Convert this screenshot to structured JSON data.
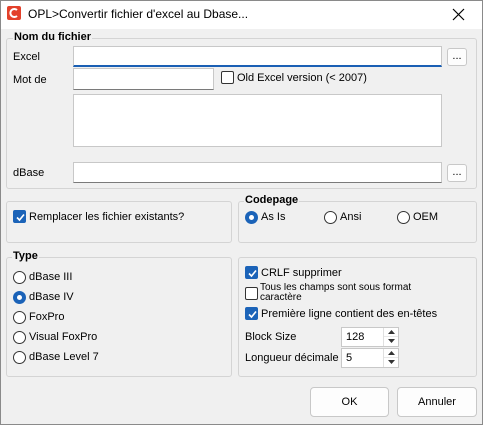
{
  "window": {
    "title": "OPL>Convertir fichier d'excel au Dbase...",
    "icon": "app-logo-icon",
    "close_icon": "close-icon"
  },
  "file_group": {
    "title": "Nom du fichier",
    "excel_label": "Excel",
    "excel_value": "",
    "password_label": "Mot de",
    "password_value": "",
    "old_excel_label": "Old Excel version (< 2007)",
    "old_excel_checked": false,
    "notes_value": "",
    "dbase_label": "dBase",
    "dbase_value": "",
    "browse_label": "..."
  },
  "replace_option": {
    "label": "Remplacer les fichier existants?",
    "checked": true
  },
  "codepage": {
    "title": "Codepage",
    "options": [
      "As Is",
      "Ansi",
      "OEM"
    ],
    "selected": "As Is"
  },
  "type_group": {
    "title": "Type",
    "options": [
      "dBase III",
      "dBase IV",
      "FoxPro",
      "Visual FoxPro",
      "dBase Level 7"
    ],
    "selected": "dBase IV"
  },
  "options_group": {
    "crlf_label": "CRLF supprimer",
    "crlf_checked": true,
    "text_fields_label": "Tous les champs sont sous format caractère",
    "text_fields_checked": false,
    "header_row_label": "Première ligne contient des en-têtes",
    "header_row_checked": true,
    "block_size_label": "Block Size",
    "block_size_value": "128",
    "decimal_length_label": "Longueur décimale",
    "decimal_length_value": "5"
  },
  "buttons": {
    "ok": "OK",
    "cancel": "Annuler"
  },
  "colors": {
    "accent": "#1b63b8",
    "window_bg": "#f0f0f0"
  }
}
